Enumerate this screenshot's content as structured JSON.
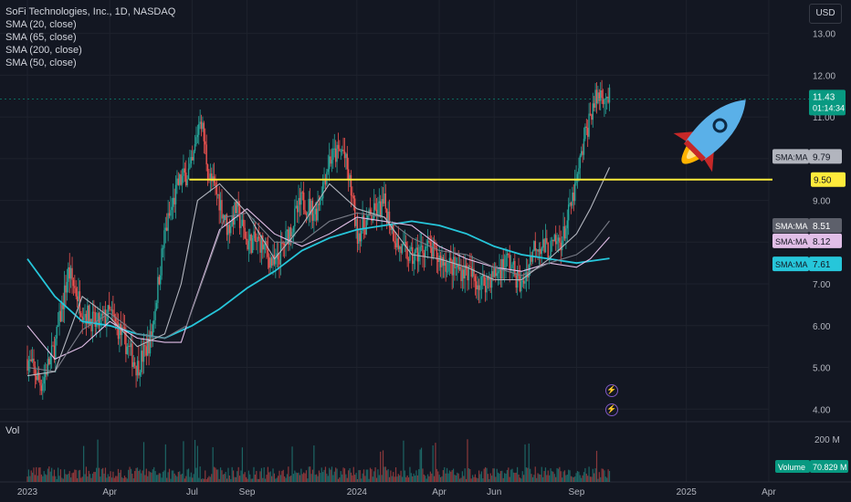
{
  "legend": {
    "title": "SoFi Technologies, Inc., 1D, NASDAQ",
    "indicators": [
      "SMA (20, close)",
      "SMA (65, close)",
      "SMA (200, close)",
      "SMA (50, close)"
    ]
  },
  "currency": "USD",
  "volume_label": "Vol",
  "icons": [
    "rocket-icon",
    "lightning-icon",
    "lightning-alert-icon"
  ],
  "colors": {
    "background": "#131722",
    "grid": "#1e222d",
    "up": "#26a69a",
    "down": "#ef5350",
    "sma20": "#b2b5be",
    "sma65": "#e1bee7",
    "sma200": "#26c6da",
    "sma50": "#787b86",
    "support": "#ffeb3b",
    "price_tag": "#089981"
  },
  "chart_data": {
    "type": "candlestick",
    "y_axis": {
      "min": 3.7,
      "max": 13.8,
      "ticks": [
        4.0,
        5.0,
        6.0,
        7.0,
        8.0,
        9.0,
        10.0,
        11.0,
        12.0,
        13.0
      ],
      "tick_labels": [
        "4.00",
        "5.00",
        "6.00",
        "7.00",
        "8.00",
        "9.00",
        "10.00",
        "11.00",
        "12.00",
        "13.00"
      ]
    },
    "x_axis": {
      "labels": [
        "2023",
        "Apr",
        "Jul",
        "Sep",
        "2024",
        "Apr",
        "Jun",
        "Sep",
        "2025",
        "Apr"
      ],
      "label_months": [
        0,
        3,
        6,
        8,
        12,
        15,
        17,
        20,
        24,
        27
      ],
      "range_months": [
        0,
        28
      ]
    },
    "last_price": {
      "value": "11.43",
      "countdown": "01:14:34"
    },
    "support_line": {
      "value": 9.5,
      "label": "9.50",
      "start_month": 5.9
    },
    "ma_labels": [
      {
        "name": "SMA:MA",
        "value": "9.79",
        "color": "#b2b5be"
      },
      {
        "name": "SMA:MA",
        "value": "8.51",
        "color": "#787b86"
      },
      {
        "name": "SMA:MA",
        "value": "8.12",
        "color": "#e1bee7"
      },
      {
        "name": "SMA:MA",
        "value": "7.61",
        "color": "#26c6da"
      }
    ],
    "volume": {
      "axis_label": "200 M",
      "last_label": "Volume",
      "last_value": "70.829 M"
    },
    "price_path": {
      "months": [
        0,
        0.5,
        1.0,
        1.5,
        2.0,
        2.5,
        3.0,
        3.5,
        4.0,
        4.5,
        5.0,
        5.5,
        6.0,
        6.3,
        6.6,
        7.0,
        7.3,
        7.6,
        8.0,
        8.5,
        9.0,
        9.5,
        10.0,
        10.5,
        11.0,
        11.5,
        11.8,
        12.0,
        12.5,
        13.0,
        13.5,
        14.0,
        14.5,
        15.0,
        15.5,
        16.0,
        16.5,
        17.0,
        17.5,
        18.0,
        18.5,
        19.0,
        19.5,
        20.0,
        20.3,
        20.6,
        20.9,
        21.2
      ],
      "close": [
        5.2,
        4.6,
        5.5,
        7.3,
        6.4,
        6.0,
        6.3,
        5.7,
        5.0,
        5.7,
        8.2,
        9.4,
        9.8,
        11.1,
        9.6,
        9.0,
        8.3,
        8.8,
        8.0,
        8.0,
        7.4,
        8.2,
        9.0,
        8.7,
        10.0,
        10.2,
        9.2,
        8.2,
        8.6,
        8.9,
        7.9,
        7.6,
        7.9,
        7.6,
        7.4,
        7.3,
        7.0,
        7.2,
        7.6,
        6.9,
        8.0,
        7.8,
        8.1,
        9.4,
        10.5,
        11.3,
        11.6,
        11.43
      ]
    },
    "sma_series": [
      {
        "key": "sma200",
        "months": [
          0,
          1,
          2,
          3,
          4,
          5,
          6,
          7,
          8,
          9,
          10,
          11,
          12,
          13,
          14,
          15,
          16,
          17,
          18,
          19,
          20,
          21.2
        ],
        "values": [
          7.6,
          6.7,
          6.1,
          6.0,
          5.8,
          5.7,
          6.0,
          6.4,
          6.9,
          7.3,
          7.8,
          8.1,
          8.3,
          8.4,
          8.5,
          8.4,
          8.2,
          7.9,
          7.7,
          7.6,
          7.5,
          7.61
        ]
      },
      {
        "key": "sma65",
        "months": [
          0,
          1,
          2,
          3,
          4,
          5,
          5.6,
          6,
          7,
          8,
          9,
          10,
          11,
          12,
          13,
          14,
          15,
          16,
          17,
          18,
          19,
          20,
          20.5,
          21.2
        ],
        "values": [
          6.0,
          5.2,
          5.5,
          6.1,
          5.7,
          5.6,
          5.6,
          6.4,
          8.3,
          8.8,
          8.2,
          7.9,
          8.2,
          8.6,
          8.5,
          8.4,
          7.9,
          7.6,
          7.4,
          7.3,
          7.5,
          7.4,
          7.6,
          8.12
        ]
      },
      {
        "key": "sma50",
        "months": [
          0,
          1,
          2,
          3,
          4,
          5,
          5.8,
          6.5,
          7.2,
          8,
          9,
          10,
          11,
          12,
          13,
          14,
          15,
          16,
          17,
          18,
          19,
          20,
          20.6,
          21.2
        ],
        "values": [
          5.0,
          4.9,
          5.9,
          6.3,
          5.8,
          5.7,
          6.0,
          7.3,
          8.6,
          8.7,
          8.0,
          8.0,
          8.5,
          8.7,
          8.6,
          8.1,
          7.8,
          7.7,
          7.4,
          7.2,
          7.5,
          7.7,
          8.0,
          8.51
        ]
      },
      {
        "key": "sma20",
        "months": [
          0,
          1,
          2,
          3,
          4,
          5,
          5.6,
          6.2,
          7,
          8,
          9,
          10,
          11,
          12,
          13,
          14,
          15,
          16,
          17,
          18,
          19,
          20,
          20.5,
          21.2
        ],
        "values": [
          4.8,
          4.9,
          6.7,
          6.2,
          5.5,
          5.8,
          7.0,
          9.0,
          9.4,
          8.7,
          7.6,
          8.4,
          9.4,
          8.8,
          8.6,
          7.7,
          7.6,
          7.4,
          7.1,
          7.1,
          7.6,
          8.2,
          8.8,
          9.79
        ]
      }
    ]
  }
}
